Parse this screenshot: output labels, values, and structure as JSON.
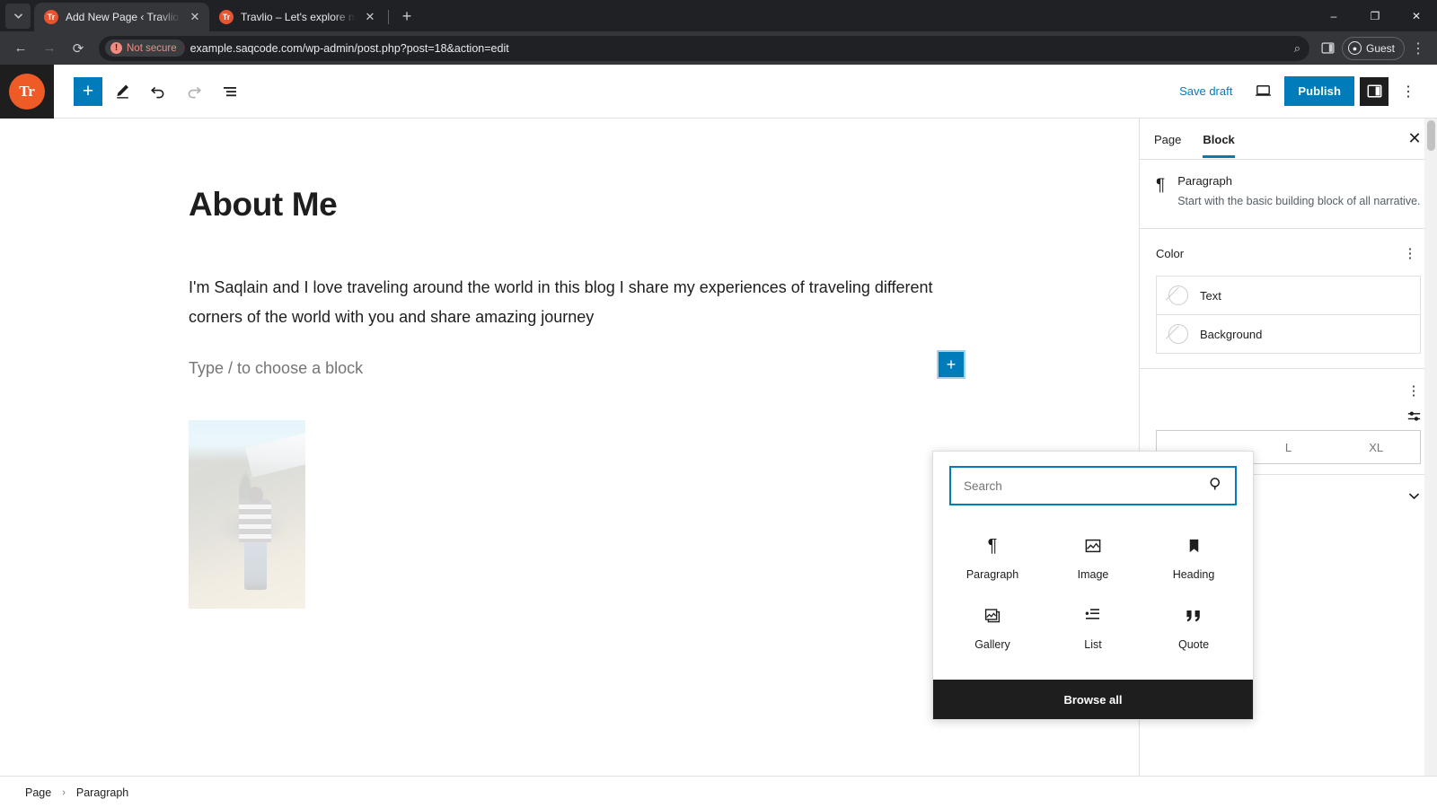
{
  "browser": {
    "tabs": [
      {
        "title": "Add New Page ‹ Travlio — Wor",
        "favicon": "Tr",
        "active": true
      },
      {
        "title": "Travlio – Let's explore natural vi",
        "favicon": "Tr",
        "active": false
      }
    ],
    "new_tab_label": "+",
    "tab_list_icon": "chevron-down-icon",
    "window_controls": {
      "minimize": "–",
      "maximize": "❐",
      "close": "✕"
    },
    "nav": {
      "back": "←",
      "forward": "→",
      "reload": "⟳"
    },
    "security_label": "Not secure",
    "url": "example.saqcode.com/wp-admin/post.php?post=18&action=edit",
    "zoom_icon": "search-icon",
    "side_panel_icon": "side-panel-icon",
    "profile_label": "Guest",
    "menu_icon": "kebab-menu-icon"
  },
  "editor": {
    "logo_text": "Tr",
    "toolbar": {
      "add_block_label": "+",
      "tools_icon": "pencil-icon",
      "undo_icon": "undo-icon",
      "redo_icon": "redo-icon",
      "list_view_icon": "list-view-icon",
      "save_draft_label": "Save draft",
      "preview_icon": "desktop-preview-icon",
      "publish_label": "Publish",
      "settings_icon": "sidebar-toggle-icon",
      "options_icon": "kebab-menu-icon"
    },
    "content": {
      "title": "About Me",
      "paragraph": "I'm Saqlain and I love traveling around the world in this blog I share my experiences of traveling different corners of the world with you and share amazing journey",
      "empty_block_placeholder": "Type / to choose a block",
      "inline_add_label": "+",
      "image_alt": "person standing on mountain hillside"
    },
    "breadcrumb": {
      "root": "Page",
      "separator": "›",
      "current": "Paragraph"
    }
  },
  "sidebar": {
    "tabs": [
      {
        "label": "Page",
        "active": false
      },
      {
        "label": "Block",
        "active": true
      }
    ],
    "close_label": "✕",
    "block_card": {
      "icon": "paragraph-icon",
      "title": "Paragraph",
      "description": "Start with the basic building block of all narrative."
    },
    "color": {
      "title": "Color",
      "options_icon": "kebab-menu-icon",
      "rows": [
        {
          "label": "Text",
          "swatch": "none"
        },
        {
          "label": "Background",
          "swatch": "none"
        }
      ]
    },
    "typography": {
      "options_icon": "kebab-menu-icon",
      "sliders_icon": "settings-sliders-icon",
      "sizes": [
        "L",
        "XL"
      ]
    },
    "advanced": {
      "chevron": "chevron-down-icon"
    }
  },
  "inserter": {
    "search_placeholder": "Search",
    "search_value": "",
    "search_icon": "search-icon",
    "blocks": [
      {
        "label": "Paragraph",
        "icon": "paragraph-icon",
        "glyph": "¶"
      },
      {
        "label": "Image",
        "icon": "image-icon",
        "glyph": "img"
      },
      {
        "label": "Heading",
        "icon": "heading-icon",
        "glyph": "bookmark"
      },
      {
        "label": "Gallery",
        "icon": "gallery-icon",
        "glyph": "gallery"
      },
      {
        "label": "List",
        "icon": "list-icon",
        "glyph": "list"
      },
      {
        "label": "Quote",
        "icon": "quote-icon",
        "glyph": "❞"
      }
    ],
    "browse_all_label": "Browse all"
  },
  "colors": {
    "accent_blue": "#007cba",
    "brand_orange": "#ef5b27",
    "dark": "#1e1e1e",
    "not_secure_red": "#f28b82"
  }
}
